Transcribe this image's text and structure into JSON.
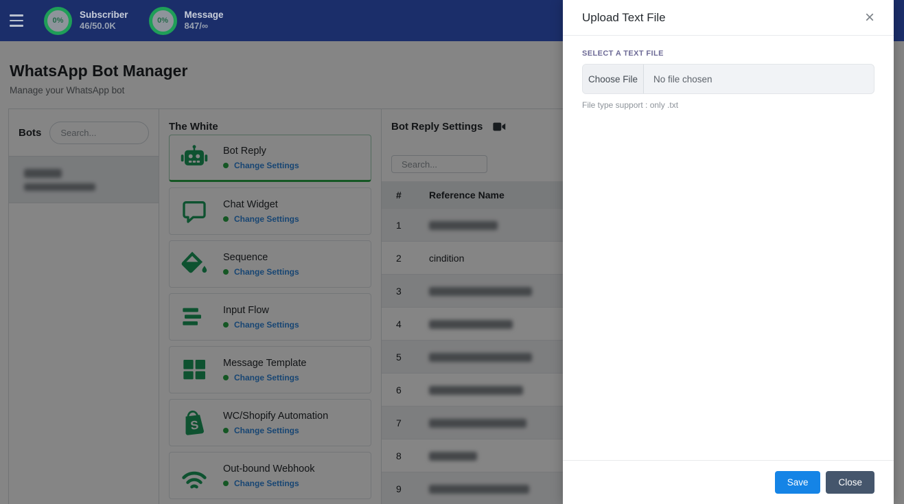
{
  "colors": {
    "navbar_bg": "#1b2e6a",
    "ring_green": "#1f9e58",
    "accent_green": "#28a745",
    "icon_green": "#1a9e5c",
    "link_blue": "#2e86de",
    "save_blue": "#1584e6",
    "close_slate": "#45566c"
  },
  "navbar": {
    "stats": [
      {
        "percent": "0%",
        "label": "Subscriber",
        "value": "46/50.0K"
      },
      {
        "percent": "0%",
        "label": "Message",
        "value": "847/∞"
      }
    ]
  },
  "page": {
    "title": "WhatsApp Bot Manager",
    "subtitle": "Manage your WhatsApp bot"
  },
  "bots_panel": {
    "title": "Bots",
    "search_placeholder": "Search...",
    "selected_item": {
      "redacted": true,
      "line1_style": "width:55px;height:13px",
      "line2_style": "width:104px;height:11px"
    }
  },
  "features_panel": {
    "title": "The White",
    "cards": [
      {
        "name": "Bot Reply",
        "link": "Change Settings",
        "icon": "robot-icon",
        "active": true
      },
      {
        "name": "Chat Widget",
        "link": "Change Settings",
        "icon": "chat-bubble-icon",
        "active": false
      },
      {
        "name": "Sequence",
        "link": "Change Settings",
        "icon": "paint-bucket-icon",
        "active": false
      },
      {
        "name": "Input Flow",
        "link": "Change Settings",
        "icon": "input-bars-icon",
        "active": false
      },
      {
        "name": "Message Template",
        "link": "Change Settings",
        "icon": "grid-icon",
        "active": false
      },
      {
        "name": "WC/Shopify Automation",
        "link": "Change Settings",
        "icon": "shopify-bag-icon",
        "active": false
      },
      {
        "name": "Out-bound Webhook",
        "link": "Change Settings",
        "icon": "wifi-arcs-icon",
        "active": false
      }
    ]
  },
  "settings_panel": {
    "title": "Bot Reply Settings",
    "title_icon": "video-camera-icon",
    "search_placeholder": "Search...",
    "columns": [
      "#",
      "Reference Name"
    ],
    "rows": [
      {
        "num": "1",
        "redact_style": "width:100px"
      },
      {
        "num": "2",
        "name": "cindition"
      },
      {
        "num": "3",
        "redact_style": "width:150px"
      },
      {
        "num": "4",
        "redact_style": "width:122px"
      },
      {
        "num": "5",
        "redact_style": "width:150px"
      },
      {
        "num": "6",
        "redact_style": "width:137px"
      },
      {
        "num": "7",
        "redact_style": "width:142px"
      },
      {
        "num": "8",
        "redact_style": "width:70px"
      },
      {
        "num": "9",
        "redact_style": "width:146px"
      }
    ]
  },
  "modal": {
    "title": "Upload Text File",
    "close_icon": "×",
    "field_label": "SELECT A TEXT FILE",
    "choose_file_label": "Choose File",
    "no_file_text": "No file chosen",
    "helper_text": "File type support : only .txt",
    "save_label": "Save",
    "close_label": "Close"
  }
}
